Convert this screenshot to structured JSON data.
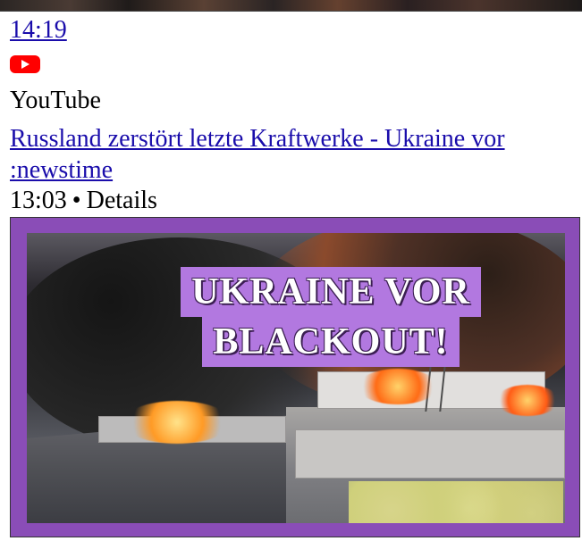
{
  "result": {
    "time_link": "14:19",
    "source_icon": "youtube-icon",
    "source_name": "YouTube",
    "title": "Russland zerstört letzte Kraftwerke - Ukraine vor",
    "title_continuation": ":newstime",
    "published_time": "13:03",
    "separator": "•",
    "details_label": "Details",
    "thumbnail": {
      "headline_line1": "UKRAINE VOR",
      "headline_line2": "BLACKOUT!"
    },
    "colors": {
      "link": "#1a0dab",
      "youtube_red": "#ff0000",
      "thumbnail_frame": "#8a4db7",
      "headline_bg": "#b278e0"
    }
  }
}
